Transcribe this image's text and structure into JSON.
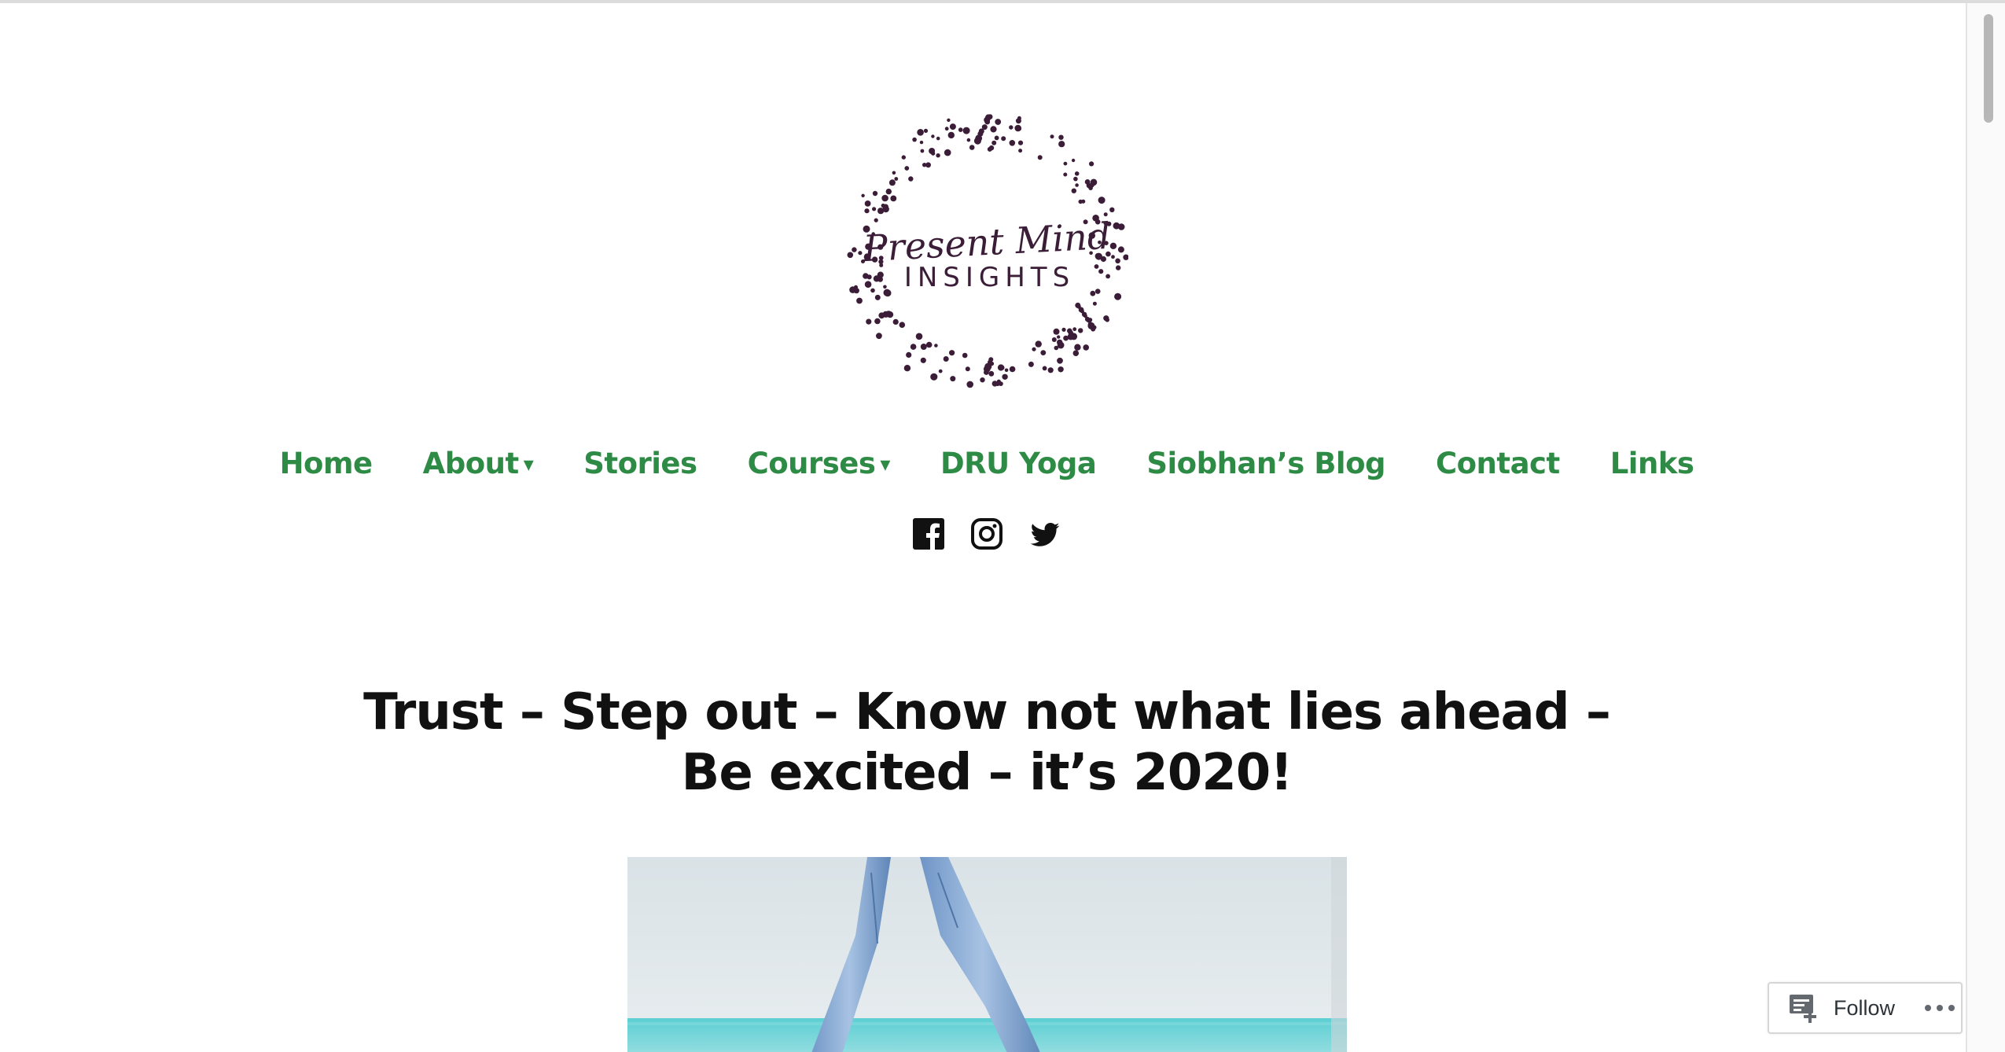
{
  "logo": {
    "line1": "Present Mind",
    "line2": "INSIGHTS",
    "color": "#3b1d38"
  },
  "nav": {
    "color": "#2e8b45",
    "items": [
      {
        "label": "Home",
        "has_dropdown": false
      },
      {
        "label": "About",
        "has_dropdown": true
      },
      {
        "label": "Stories",
        "has_dropdown": false
      },
      {
        "label": "Courses",
        "has_dropdown": true
      },
      {
        "label": "DRU Yoga",
        "has_dropdown": false
      },
      {
        "label": "Siobhan’s Blog",
        "has_dropdown": false
      },
      {
        "label": "Contact",
        "has_dropdown": false
      },
      {
        "label": "Links",
        "has_dropdown": false
      }
    ],
    "dropdown_glyph": "▾"
  },
  "social": {
    "icons": [
      "facebook-icon",
      "instagram-icon",
      "twitter-icon"
    ]
  },
  "post": {
    "title": "Trust – Step out – Know not what lies ahead – Be excited – it’s 2020!"
  },
  "follow_widget": {
    "label": "Follow",
    "icon": "reader-follow-icon",
    "more_icon": "ellipsis-icon"
  }
}
